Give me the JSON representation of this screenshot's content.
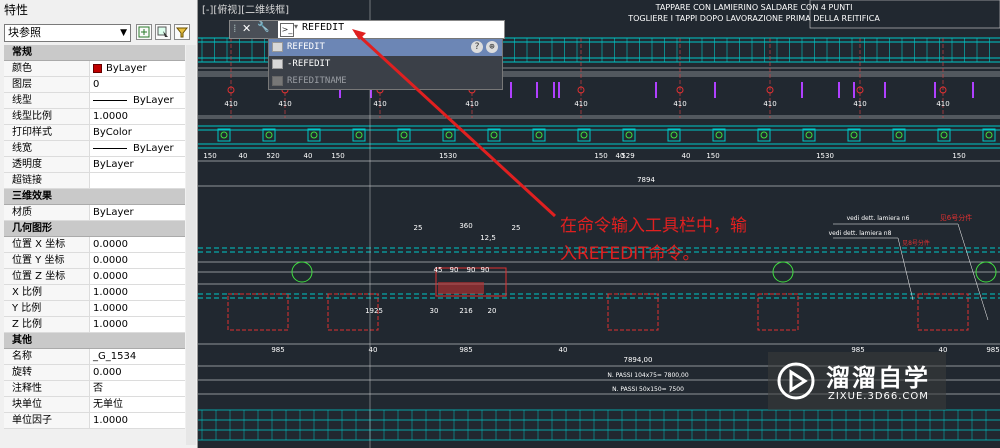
{
  "palette": {
    "title": "特性",
    "object_type": "块参照",
    "sections": [
      {
        "name": "常规",
        "rows": [
          {
            "key": "颜色",
            "value": "ByLayer",
            "swatch": "#c00000"
          },
          {
            "key": "图层",
            "value": "0"
          },
          {
            "key": "线型",
            "value": "ByLayer",
            "line": true
          },
          {
            "key": "线型比例",
            "value": "1.0000"
          },
          {
            "key": "打印样式",
            "value": "ByColor"
          },
          {
            "key": "线宽",
            "value": "ByLayer",
            "line": true
          },
          {
            "key": "透明度",
            "value": "ByLayer"
          },
          {
            "key": "超链接",
            "value": ""
          }
        ]
      },
      {
        "name": "三维效果",
        "rows": [
          {
            "key": "材质",
            "value": "ByLayer"
          }
        ]
      },
      {
        "name": "几何图形",
        "rows": [
          {
            "key": "位置 X 坐标",
            "value": "0.0000"
          },
          {
            "key": "位置 Y 坐标",
            "value": "0.0000"
          },
          {
            "key": "位置 Z 坐标",
            "value": "0.0000"
          },
          {
            "key": "X 比例",
            "value": "1.0000"
          },
          {
            "key": "Y 比例",
            "value": "1.0000"
          },
          {
            "key": "Z 比例",
            "value": "1.0000"
          }
        ]
      },
      {
        "name": "其他",
        "rows": [
          {
            "key": "名称",
            "value": "_G_1534"
          },
          {
            "key": "旋转",
            "value": "0.000"
          },
          {
            "key": "注释性",
            "value": "否"
          },
          {
            "key": "块单位",
            "value": "无单位"
          },
          {
            "key": "单位因子",
            "value": "1.0000"
          }
        ]
      }
    ]
  },
  "viewport": {
    "label": "[-][俯视][二维线框]",
    "drawing_notes": [
      "TAPPARE CON LAMIERINO SALDARE CON 4 PUNTI",
      "TOGLIERE I TAPPI DOPO LAVORAZIONE PRIMA DELLA REITIFICA"
    ],
    "dims_top": [
      "410",
      "410",
      "410",
      "410",
      "410",
      "410",
      "410",
      "410",
      "410"
    ],
    "dims_row2": [
      "150",
      "40",
      "520",
      "40",
      "150",
      "1530",
      "150",
      "40",
      "529",
      "40",
      "150",
      "1530",
      "150"
    ],
    "dim_total": "7894",
    "dims_section": [
      "25",
      "360",
      "25",
      "45",
      "90",
      "90",
      "90",
      "30",
      "216",
      "20",
      "12,5",
      "1925"
    ],
    "dims_bottom": [
      "985",
      "40",
      "985",
      "40",
      "985",
      "40",
      "985"
    ],
    "dim_total_bottom": "7894,00",
    "passi": [
      "N. PASSI 104x75= 7800,00",
      "N. PASSI 50x150= 7500"
    ],
    "refs": [
      "vedi dett. lamiera n6",
      "vedi dett. lamiera n8"
    ],
    "refs_red": [
      "见6号分件",
      "见8号分件"
    ]
  },
  "command": {
    "text": "REFEDIT",
    "close": "✕",
    "settings": "🔧",
    "suggestions": [
      "REFEDIT",
      "-REFEDIT",
      "REFEDITNAME"
    ]
  },
  "annotation": "在命令输入工具栏中，输入REFEDIT命令。",
  "watermark": {
    "title": "溜溜自学",
    "url": "ZIXUE.3D66.COM"
  },
  "colors": {
    "cad_bg": "#212830",
    "cyan": "#00c8c8",
    "annotation": "#e02020",
    "highlight": "#6c86b5"
  }
}
